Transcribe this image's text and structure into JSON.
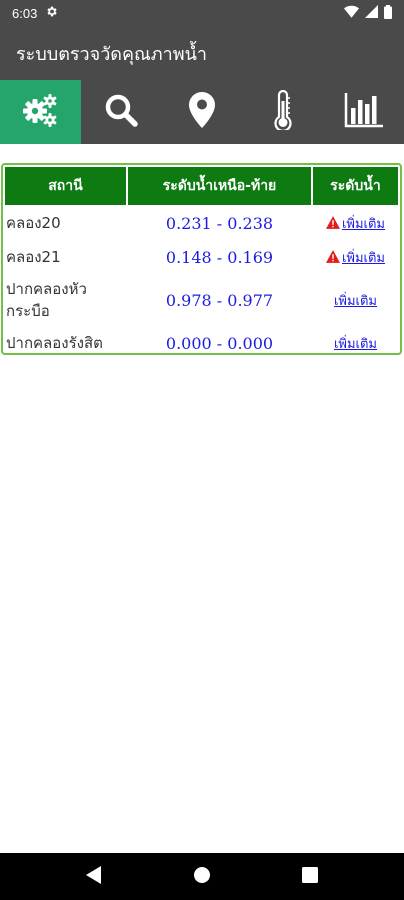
{
  "status_bar": {
    "time": "6:03",
    "icons": [
      "gear-icon",
      "wifi-icon",
      "signal-icon",
      "battery-icon"
    ]
  },
  "app": {
    "title": "ระบบตรวจวัดคุณภาพน้ำ"
  },
  "toolbar": {
    "items": [
      {
        "icon": "gears-icon",
        "active": true
      },
      {
        "icon": "search-icon",
        "active": false
      },
      {
        "icon": "map-pin-icon",
        "active": false
      },
      {
        "icon": "thermometer-icon",
        "active": false
      },
      {
        "icon": "bar-chart-icon",
        "active": false
      }
    ]
  },
  "table": {
    "headers": [
      "สถานี",
      "ระดับน้ำเหนือ-ท้าย",
      "ระดับน้ำ"
    ],
    "rows": [
      {
        "station": "คลอง20",
        "levels": "0.231 - 0.238",
        "alert": true,
        "more": "เพิ่มเติม"
      },
      {
        "station": "คลอง21",
        "levels": "0.148 - 0.169",
        "alert": true,
        "more": "เพิ่มเติม"
      },
      {
        "station": "ปากคลองหัวกระบือ",
        "levels": "0.978 - 0.977",
        "alert": false,
        "more": "เพิ่มเติม"
      },
      {
        "station": "ปากคลองรังสิต",
        "levels": "0.000 - 0.000",
        "alert": false,
        "more": "เพิ่มเติม"
      }
    ]
  },
  "colors": {
    "header_green": "#0d7a12",
    "active_tab": "#25a56b",
    "panel_border": "#73c046",
    "bar_gray": "#4a4a4a",
    "value_blue": "#1c1ce0",
    "alert_red": "#e11d1d"
  },
  "nav_bar": {
    "icons": [
      "back-icon",
      "home-icon",
      "recents-icon"
    ]
  }
}
